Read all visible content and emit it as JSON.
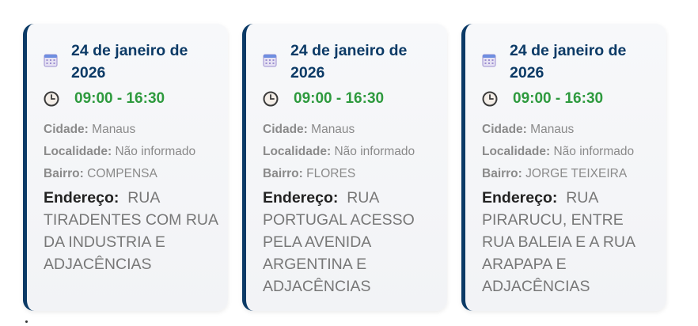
{
  "colors": {
    "accent_border": "#0b3a66",
    "date_text": "#0b3a66",
    "time_text": "#2e9a3e"
  },
  "icons": {
    "calendar": "calendar-icon",
    "clock": "clock-icon"
  },
  "labels": {
    "city": "Cidade:",
    "locality": "Localidade:",
    "district": "Bairro:",
    "address": "Endereço:"
  },
  "cards": [
    {
      "date": "24 de janeiro de 2026",
      "time": "09:00 - 16:30",
      "city": "Manaus",
      "locality": "Não informado",
      "district": "COMPENSA",
      "address": "RUA TIRADENTES COM RUA DA INDUSTRIA E ADJACÊNCIAS"
    },
    {
      "date": "24 de janeiro de 2026",
      "time": "09:00 - 16:30",
      "city": "Manaus",
      "locality": "Não informado",
      "district": "FLORES",
      "address": "RUA PORTUGAL ACESSO PELA AVENIDA ARGENTINA E ADJACÊNCIAS"
    },
    {
      "date": "24 de janeiro de 2026",
      "time": "09:00 - 16:30",
      "city": "Manaus",
      "locality": "Não informado",
      "district": "JORGE TEIXEIRA",
      "address": "RUA PIRARUCU, ENTRE RUA BALEIA E A RUA ARAPAPA E ADJACÊNCIAS"
    }
  ]
}
